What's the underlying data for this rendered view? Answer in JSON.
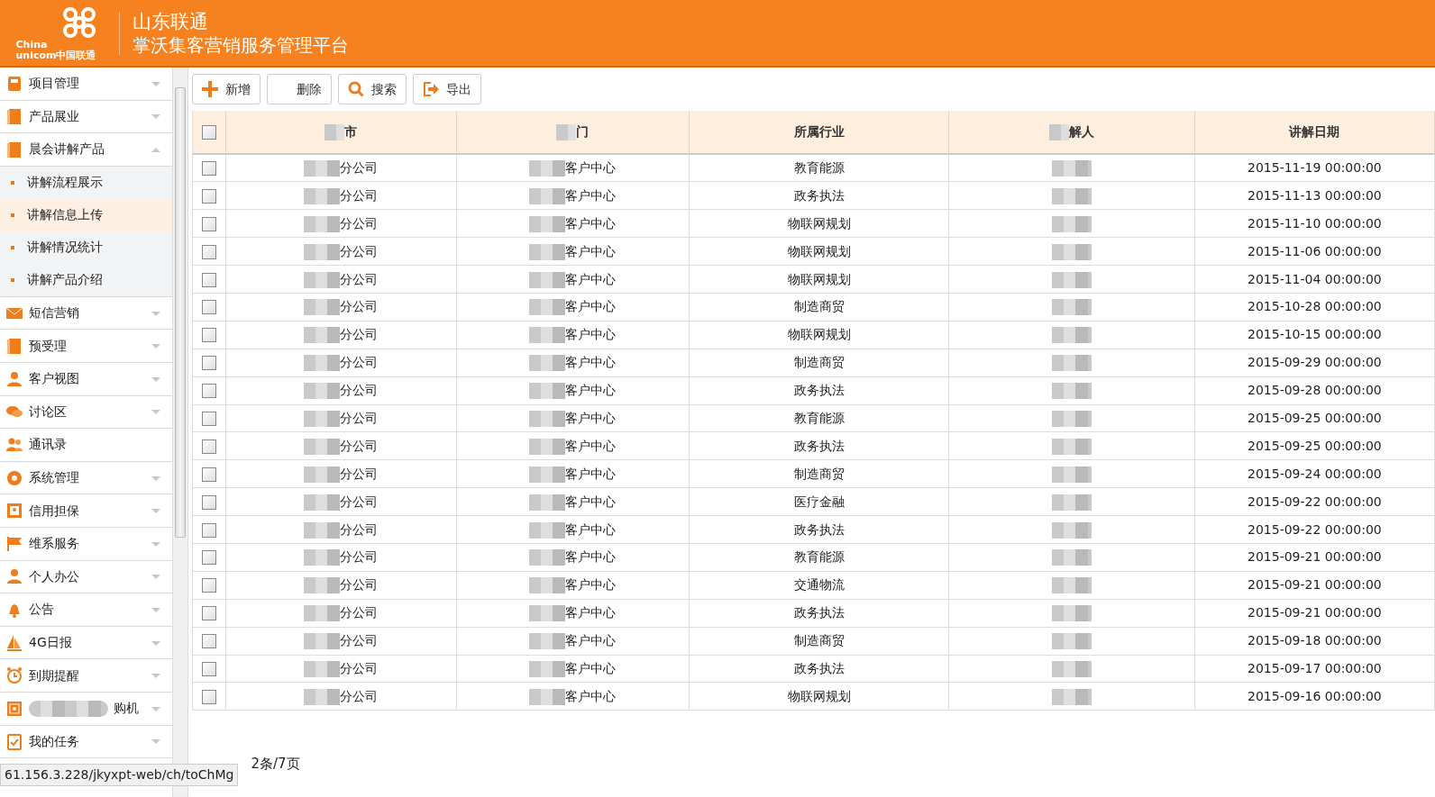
{
  "header": {
    "brand_line_1": "China",
    "brand_line_2": "unicom中国联通",
    "title": "山东联通",
    "subtitle": "掌沃集客营销服务管理平台"
  },
  "sidebar": {
    "items": [
      {
        "label": "项目管理",
        "expanded": false,
        "redacted": false
      },
      {
        "label": "产品展业",
        "expanded": false,
        "redacted": false
      },
      {
        "label": "晨会讲解产品",
        "expanded": true,
        "redacted": false,
        "children": [
          {
            "label": "讲解流程展示",
            "selected": false
          },
          {
            "label": "讲解信息上传",
            "selected": true
          },
          {
            "label": "讲解情况统计",
            "selected": false
          },
          {
            "label": "讲解产品介绍",
            "selected": false
          }
        ]
      },
      {
        "label": "短信营销",
        "expanded": false,
        "redacted": false
      },
      {
        "label": "预受理",
        "expanded": false,
        "redacted": false
      },
      {
        "label": "客户视图",
        "expanded": false,
        "redacted": false
      },
      {
        "label": "讨论区",
        "expanded": false,
        "redacted": false
      },
      {
        "label": "通讯录",
        "expanded": false,
        "redacted": false,
        "no_caret": true
      },
      {
        "label": "系统管理",
        "expanded": false,
        "redacted": false
      },
      {
        "label": "信用担保",
        "expanded": false,
        "redacted": false
      },
      {
        "label": "维系服务",
        "expanded": false,
        "redacted": false
      },
      {
        "label": "个人办公",
        "expanded": false,
        "redacted": false
      },
      {
        "label": "公告",
        "expanded": false,
        "redacted": false
      },
      {
        "label": "4G日报",
        "expanded": false,
        "redacted": false
      },
      {
        "label": "到期提醒",
        "expanded": false,
        "redacted": false
      },
      {
        "label": "购机",
        "expanded": false,
        "redacted": true
      },
      {
        "label": "我的任务",
        "expanded": false,
        "redacted": false
      }
    ]
  },
  "toolbar": {
    "buttons": [
      {
        "label": "新增",
        "kind": "add"
      },
      {
        "label": "删除",
        "kind": "delete"
      },
      {
        "label": "搜索",
        "kind": "search"
      },
      {
        "label": "导出",
        "kind": "export"
      }
    ]
  },
  "table": {
    "select_all_checked": false,
    "columns": [
      {
        "label": "市",
        "redacted": true
      },
      {
        "label": "门",
        "redacted": true
      },
      {
        "label": "所属行业",
        "redacted": false
      },
      {
        "label": "解人",
        "redacted": true
      },
      {
        "label": "讲解日期",
        "redacted": false
      }
    ],
    "rows": [
      {
        "checked": false,
        "cells": [
          "分公司",
          "客户中心",
          "教育能源",
          "",
          "2015-11-19 00:00:00"
        ]
      },
      {
        "checked": false,
        "cells": [
          "分公司",
          "客户中心",
          "政务执法",
          "",
          "2015-11-13 00:00:00"
        ]
      },
      {
        "checked": false,
        "cells": [
          "分公司",
          "客户中心",
          "物联网规划",
          "",
          "2015-11-10 00:00:00"
        ]
      },
      {
        "checked": false,
        "cells": [
          "分公司",
          "客户中心",
          "物联网规划",
          "",
          "2015-11-06 00:00:00"
        ]
      },
      {
        "checked": false,
        "cells": [
          "分公司",
          "客户中心",
          "物联网规划",
          "",
          "2015-11-04 00:00:00"
        ]
      },
      {
        "checked": false,
        "cells": [
          "分公司",
          "客户中心",
          "制造商贸",
          "",
          "2015-10-28 00:00:00"
        ]
      },
      {
        "checked": false,
        "cells": [
          "分公司",
          "客户中心",
          "物联网规划",
          "",
          "2015-10-15 00:00:00"
        ]
      },
      {
        "checked": false,
        "cells": [
          "分公司",
          "客户中心",
          "制造商贸",
          "",
          "2015-09-29 00:00:00"
        ]
      },
      {
        "checked": false,
        "cells": [
          "分公司",
          "客户中心",
          "政务执法",
          "",
          "2015-09-28 00:00:00"
        ]
      },
      {
        "checked": false,
        "cells": [
          "分公司",
          "客户中心",
          "教育能源",
          "",
          "2015-09-25 00:00:00"
        ]
      },
      {
        "checked": false,
        "cells": [
          "分公司",
          "客户中心",
          "政务执法",
          "",
          "2015-09-25 00:00:00"
        ]
      },
      {
        "checked": false,
        "cells": [
          "分公司",
          "客户中心",
          "制造商贸",
          "",
          "2015-09-24 00:00:00"
        ]
      },
      {
        "checked": false,
        "cells": [
          "分公司",
          "客户中心",
          "医疗金融",
          "",
          "2015-09-22 00:00:00"
        ]
      },
      {
        "checked": false,
        "cells": [
          "分公司",
          "客户中心",
          "政务执法",
          "",
          "2015-09-22 00:00:00"
        ]
      },
      {
        "checked": false,
        "cells": [
          "分公司",
          "客户中心",
          "教育能源",
          "",
          "2015-09-21 00:00:00"
        ]
      },
      {
        "checked": false,
        "cells": [
          "分公司",
          "客户中心",
          "交通物流",
          "",
          "2015-09-21 00:00:00"
        ]
      },
      {
        "checked": false,
        "cells": [
          "分公司",
          "客户中心",
          "政务执法",
          "",
          "2015-09-21 00:00:00"
        ]
      },
      {
        "checked": false,
        "cells": [
          "分公司",
          "客户中心",
          "制造商贸",
          "",
          "2015-09-18 00:00:00"
        ]
      },
      {
        "checked": false,
        "cells": [
          "分公司",
          "客户中心",
          "政务执法",
          "",
          "2015-09-17 00:00:00"
        ]
      },
      {
        "checked": false,
        "cells": [
          "分公司",
          "客户中心",
          "物联网规划",
          "",
          "2015-09-16 00:00:00"
        ]
      }
    ]
  },
  "pagination": {
    "summary": "2条/7页"
  },
  "status_bar": {
    "url": "61.156.3.228/jkyxpt-web/ch/toChMg"
  }
}
